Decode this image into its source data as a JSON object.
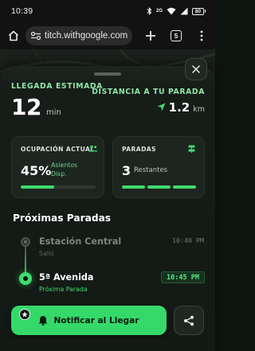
{
  "status_bar": {
    "time": "10:39",
    "battery": "80",
    "network": "2G"
  },
  "browser": {
    "url": "titch.withgoogle.com",
    "tab_count": "5"
  },
  "eta": {
    "label": "LLEGADA ESTIMADA",
    "value": "12",
    "unit": "min"
  },
  "distance": {
    "label": "DISTANCIA A TU PARADA",
    "value": "1.2",
    "unit": "km"
  },
  "occupancy": {
    "title": "OCUPACIÓN ACTUAL",
    "percent_label": "45%",
    "percent_value": 45,
    "sub_line1": "Asientos",
    "sub_line2": "Disp."
  },
  "stops": {
    "title": "PARADAS",
    "count": "3",
    "label": "Restantes",
    "segments_total": 3,
    "segments_filled": 3
  },
  "next_stops": {
    "title": "Próximas Paradas",
    "items": [
      {
        "name": "Estación Central",
        "status": "Salió",
        "time": "10:40 PM"
      },
      {
        "name": "5ª Avenida",
        "status": "Próxima Parada",
        "time": "10:45 PM"
      }
    ]
  },
  "actions": {
    "notify_label": "Notificar al Llegar"
  },
  "colors": {
    "accent": "#3fdc6e",
    "label_green": "#8fe5a7",
    "background": "#131915"
  }
}
